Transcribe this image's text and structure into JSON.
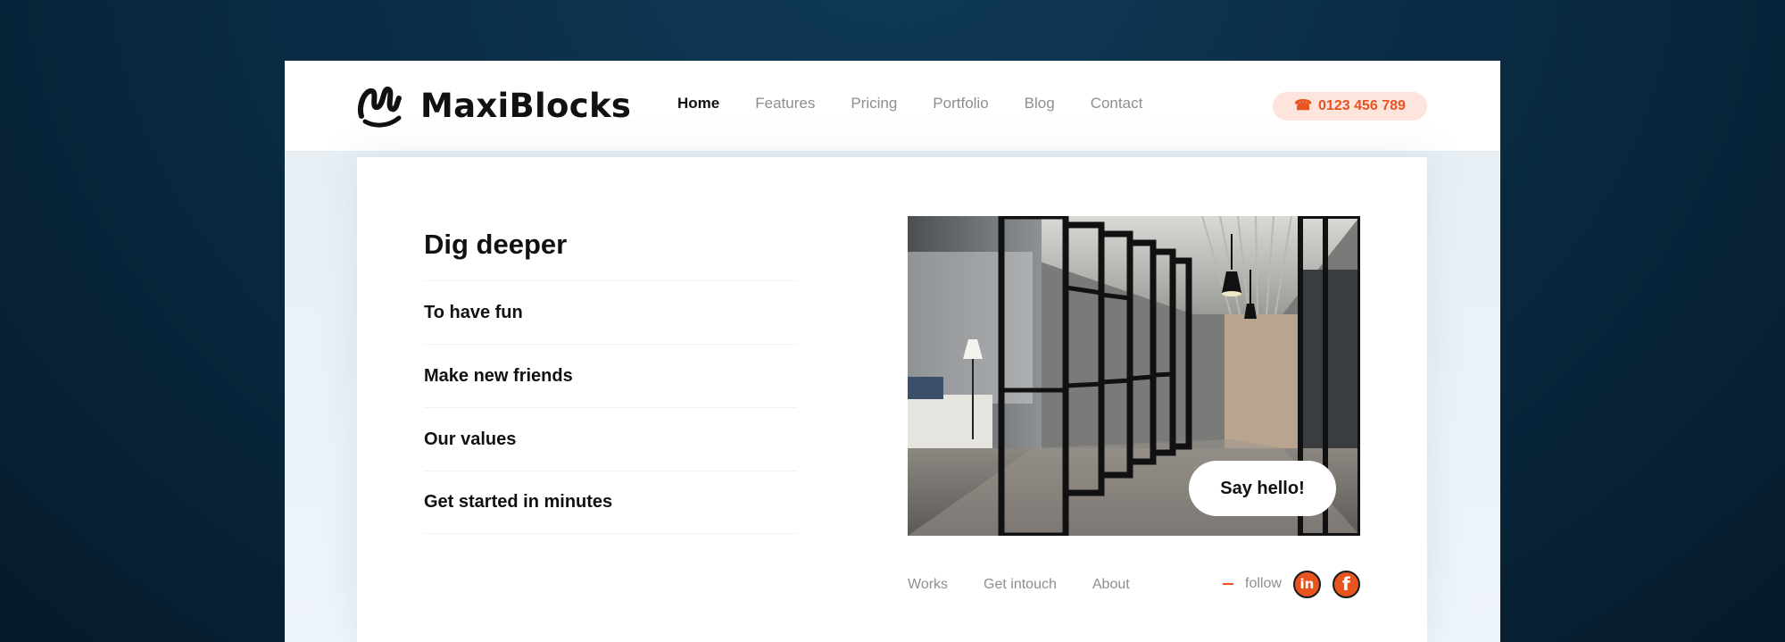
{
  "brand": {
    "name": "MaxiBlocks",
    "logo_icon": "maxiblocks-logo"
  },
  "nav": {
    "items": [
      {
        "label": "Home",
        "active": true
      },
      {
        "label": "Features",
        "active": false
      },
      {
        "label": "Pricing",
        "active": false
      },
      {
        "label": "Portfolio",
        "active": false
      },
      {
        "label": "Blog",
        "active": false
      },
      {
        "label": "Contact",
        "active": false
      }
    ]
  },
  "phone": {
    "icon": "phone-icon",
    "number": "0123 456 789"
  },
  "content": {
    "heading": "Dig deeper",
    "list": [
      "To have fun",
      "Make new friends",
      "Our values",
      "Get started in minutes"
    ]
  },
  "hero_image": {
    "cta_label": "Say hello!"
  },
  "footer": {
    "links": [
      "Works",
      "Get intouch",
      "About"
    ],
    "follow_label": "follow",
    "social": [
      {
        "icon": "linkedin-icon",
        "glyph": "in"
      },
      {
        "icon": "facebook-icon",
        "glyph": "f"
      }
    ]
  },
  "colors": {
    "accent": "#e8531e",
    "accent_soft": "#fde4dc",
    "background_dark": "#0a2c45",
    "text_primary": "#111111",
    "text_muted": "#8e8e8e"
  }
}
